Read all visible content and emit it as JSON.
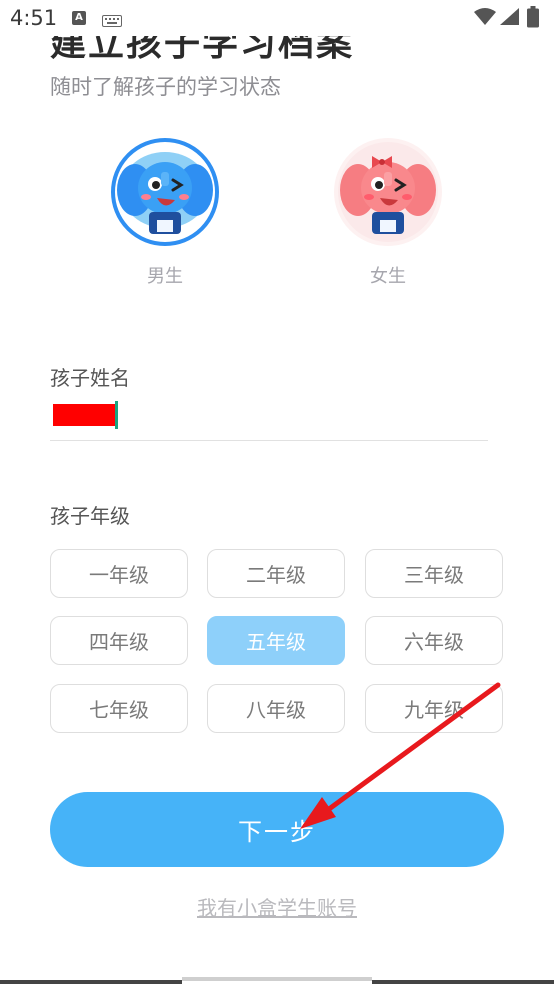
{
  "status_bar": {
    "time": "4:51",
    "notification_icon_letter": "A",
    "icons": [
      "keyboard-icon",
      "wifi-icon",
      "signal-icon",
      "battery-icon"
    ]
  },
  "header": {
    "title": "建立孩子学习档案",
    "subtitle": "随时了解孩子的学习状态"
  },
  "gender": {
    "options": [
      {
        "label": "男生",
        "selected": true
      },
      {
        "label": "女生",
        "selected": false
      }
    ]
  },
  "name_field": {
    "label": "孩子姓名"
  },
  "grade": {
    "label": "孩子年级",
    "options": [
      {
        "label": "一年级",
        "selected": false
      },
      {
        "label": "二年级",
        "selected": false
      },
      {
        "label": "三年级",
        "selected": false
      },
      {
        "label": "四年级",
        "selected": false
      },
      {
        "label": "五年级",
        "selected": true
      },
      {
        "label": "六年级",
        "selected": false
      },
      {
        "label": "七年级",
        "selected": false
      },
      {
        "label": "八年级",
        "selected": false
      },
      {
        "label": "九年级",
        "selected": false
      }
    ]
  },
  "next_button": {
    "label": "下一步"
  },
  "account_link": {
    "label": "我有小盒学生账号"
  },
  "colors": {
    "accent": "#46b3f8",
    "selected_grade": "#8ed0fa",
    "annotation_arrow": "#e8191d"
  }
}
